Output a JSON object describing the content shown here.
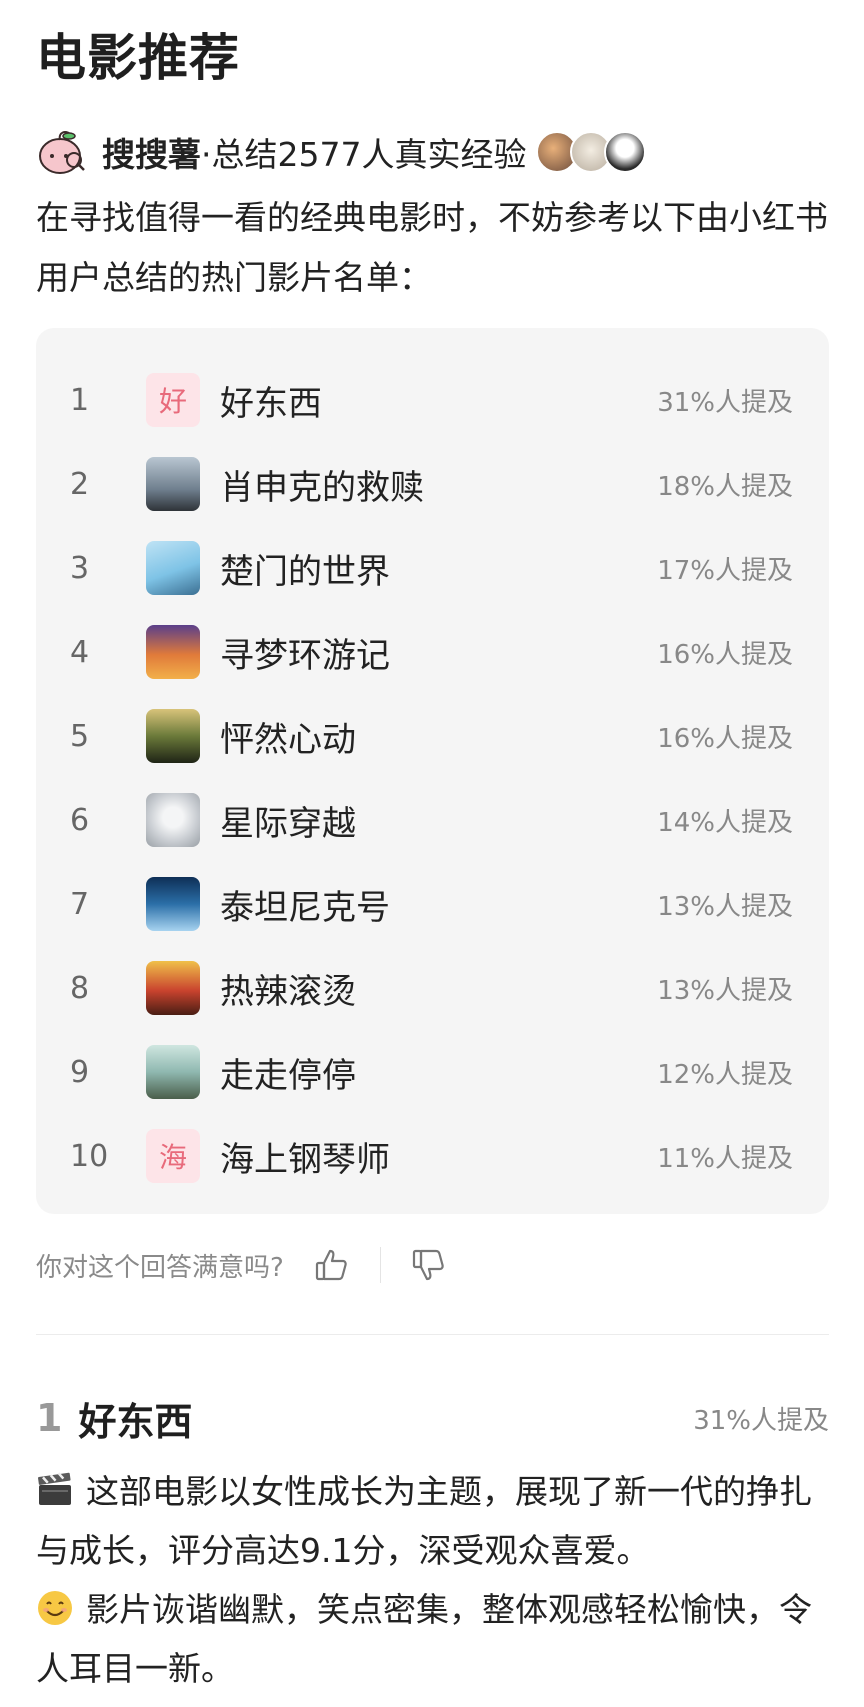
{
  "title": "电影推荐",
  "source": {
    "brand": "搜搜薯",
    "summary": "·总结2577人真实经验"
  },
  "intro": "在寻找值得一看的经典电影时，不妨参考以下由小红书用户总结的热门影片名单：",
  "ranking": [
    {
      "rank": "1",
      "name": "好东西",
      "mention": "31%人提及",
      "thumb_char": "好",
      "thumb_icon": "text-thumb-icon"
    },
    {
      "rank": "2",
      "name": "肖申克的救赎",
      "mention": "18%人提及",
      "thumb_icon": "movie-poster-icon",
      "thumb_color": "#8fa1b3"
    },
    {
      "rank": "3",
      "name": "楚门的世界",
      "mention": "17%人提及",
      "thumb_icon": "movie-poster-icon",
      "thumb_color": "#7ec3e6"
    },
    {
      "rank": "4",
      "name": "寻梦环游记",
      "mention": "16%人提及",
      "thumb_icon": "movie-poster-icon",
      "thumb_color": "#e07a3a"
    },
    {
      "rank": "5",
      "name": "怦然心动",
      "mention": "16%人提及",
      "thumb_icon": "movie-poster-icon",
      "thumb_color": "#3d4a2a"
    },
    {
      "rank": "6",
      "name": "星际穿越",
      "mention": "14%人提及",
      "thumb_icon": "movie-poster-icon",
      "thumb_color": "#c9cdd2"
    },
    {
      "rank": "7",
      "name": "泰坦尼克号",
      "mention": "13%人提及",
      "thumb_icon": "movie-poster-icon",
      "thumb_color": "#2b6fa8"
    },
    {
      "rank": "8",
      "name": "热辣滚烫",
      "mention": "13%人提及",
      "thumb_icon": "movie-poster-icon",
      "thumb_color": "#c9432e"
    },
    {
      "rank": "9",
      "name": "走走停停",
      "mention": "12%人提及",
      "thumb_icon": "movie-poster-icon",
      "thumb_color": "#8fb8b0"
    },
    {
      "rank": "10",
      "name": "海上钢琴师",
      "mention": "11%人提及",
      "thumb_char": "海",
      "thumb_icon": "text-thumb-icon"
    }
  ],
  "feedback": {
    "question": "你对这个回答满意吗?"
  },
  "detail": {
    "rank": "1",
    "name": "好东西",
    "mention": "31%人提及",
    "paragraphs": [
      {
        "icon": "clapperboard-emoji-icon",
        "text": "这部电影以女性成长为主题，展现了新一代的挣扎与成长，评分高达9.1分，深受观众喜爱。"
      },
      {
        "icon": "smiley-emoji-icon",
        "text": "影片诙谐幽默，笑点密集，整体观感轻松愉快，令人耳目一新。"
      }
    ]
  },
  "colors": {
    "card_bg": "#f5f5f5",
    "text_thumb_bg": "#fde4e8",
    "text_thumb_fg": "#e86a7b"
  }
}
